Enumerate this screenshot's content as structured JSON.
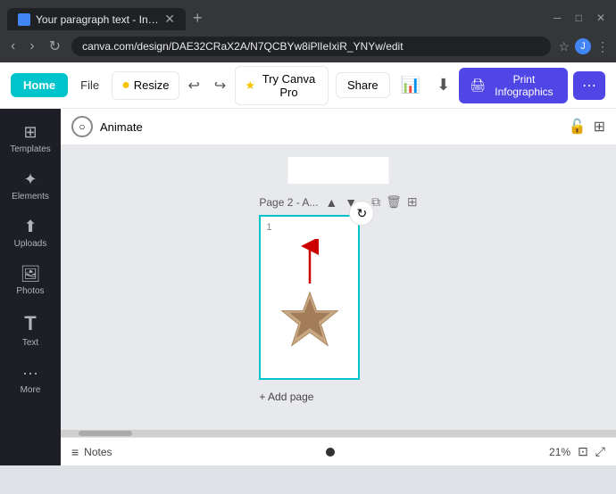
{
  "browser": {
    "tab_title": "Your paragraph text - Infographic...",
    "address": "canva.com/design/DAE32CRaX2A/N7QCBYw8iPlIeIxiR_YNYw/edit",
    "window_buttons": [
      "minimize",
      "maximize",
      "close"
    ]
  },
  "toolbar": {
    "home_label": "Home",
    "file_label": "File",
    "resize_label": "Resize",
    "trypro_label": "Try Canva Pro",
    "share_label": "Share",
    "print_label": "Print Infographics",
    "animate_label": "Animate"
  },
  "sidebar": {
    "items": [
      {
        "label": "Templates",
        "icon": "⊞"
      },
      {
        "label": "Elements",
        "icon": "✦"
      },
      {
        "label": "Uploads",
        "icon": "⬆"
      },
      {
        "label": "Photos",
        "icon": "🖼"
      },
      {
        "label": "Text",
        "icon": "T"
      },
      {
        "label": "More",
        "icon": "···"
      }
    ]
  },
  "canvas": {
    "page_label": "Page 2 - A...",
    "page_num": "1",
    "add_page_label": "+ Add page",
    "rotate_icon": "↻"
  },
  "bottom_bar": {
    "notes_label": "Notes",
    "zoom_pct": "21%"
  }
}
